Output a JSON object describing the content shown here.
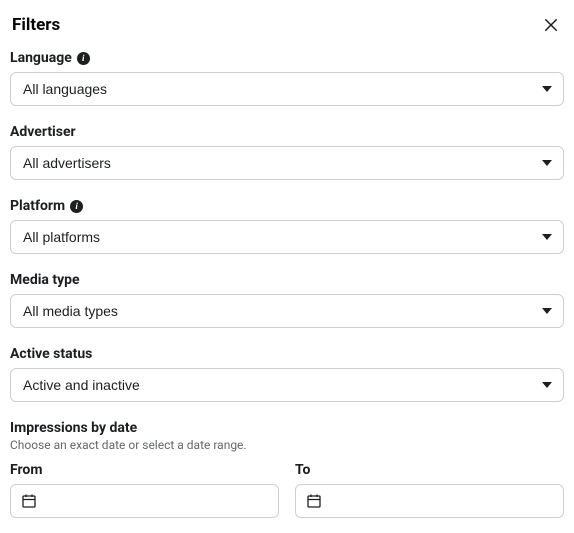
{
  "header": {
    "title": "Filters"
  },
  "filters": {
    "language": {
      "label": "Language",
      "value": "All languages"
    },
    "advertiser": {
      "label": "Advertiser",
      "value": "All advertisers"
    },
    "platform": {
      "label": "Platform",
      "value": "All platforms"
    },
    "media_type": {
      "label": "Media type",
      "value": "All media types"
    },
    "active_status": {
      "label": "Active status",
      "value": "Active and inactive"
    }
  },
  "impressions": {
    "label": "Impressions by date",
    "desc": "Choose an exact date or select a date range.",
    "from_label": "From",
    "to_label": "To"
  }
}
